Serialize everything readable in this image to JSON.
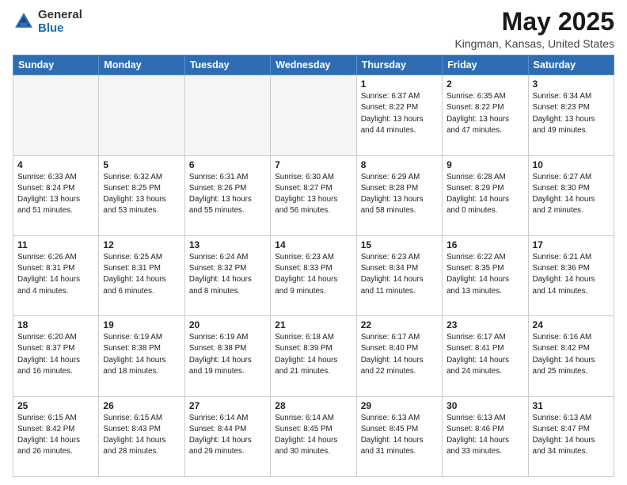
{
  "header": {
    "logo_line1": "General",
    "logo_line2": "Blue",
    "month": "May 2025",
    "location": "Kingman, Kansas, United States"
  },
  "weekdays": [
    "Sunday",
    "Monday",
    "Tuesday",
    "Wednesday",
    "Thursday",
    "Friday",
    "Saturday"
  ],
  "weeks": [
    [
      {
        "day": "",
        "info": ""
      },
      {
        "day": "",
        "info": ""
      },
      {
        "day": "",
        "info": ""
      },
      {
        "day": "",
        "info": ""
      },
      {
        "day": "1",
        "info": "Sunrise: 6:37 AM\nSunset: 8:22 PM\nDaylight: 13 hours\nand 44 minutes."
      },
      {
        "day": "2",
        "info": "Sunrise: 6:35 AM\nSunset: 8:22 PM\nDaylight: 13 hours\nand 47 minutes."
      },
      {
        "day": "3",
        "info": "Sunrise: 6:34 AM\nSunset: 8:23 PM\nDaylight: 13 hours\nand 49 minutes."
      }
    ],
    [
      {
        "day": "4",
        "info": "Sunrise: 6:33 AM\nSunset: 8:24 PM\nDaylight: 13 hours\nand 51 minutes."
      },
      {
        "day": "5",
        "info": "Sunrise: 6:32 AM\nSunset: 8:25 PM\nDaylight: 13 hours\nand 53 minutes."
      },
      {
        "day": "6",
        "info": "Sunrise: 6:31 AM\nSunset: 8:26 PM\nDaylight: 13 hours\nand 55 minutes."
      },
      {
        "day": "7",
        "info": "Sunrise: 6:30 AM\nSunset: 8:27 PM\nDaylight: 13 hours\nand 56 minutes."
      },
      {
        "day": "8",
        "info": "Sunrise: 6:29 AM\nSunset: 8:28 PM\nDaylight: 13 hours\nand 58 minutes."
      },
      {
        "day": "9",
        "info": "Sunrise: 6:28 AM\nSunset: 8:29 PM\nDaylight: 14 hours\nand 0 minutes."
      },
      {
        "day": "10",
        "info": "Sunrise: 6:27 AM\nSunset: 8:30 PM\nDaylight: 14 hours\nand 2 minutes."
      }
    ],
    [
      {
        "day": "11",
        "info": "Sunrise: 6:26 AM\nSunset: 8:31 PM\nDaylight: 14 hours\nand 4 minutes."
      },
      {
        "day": "12",
        "info": "Sunrise: 6:25 AM\nSunset: 8:31 PM\nDaylight: 14 hours\nand 6 minutes."
      },
      {
        "day": "13",
        "info": "Sunrise: 6:24 AM\nSunset: 8:32 PM\nDaylight: 14 hours\nand 8 minutes."
      },
      {
        "day": "14",
        "info": "Sunrise: 6:23 AM\nSunset: 8:33 PM\nDaylight: 14 hours\nand 9 minutes."
      },
      {
        "day": "15",
        "info": "Sunrise: 6:23 AM\nSunset: 8:34 PM\nDaylight: 14 hours\nand 11 minutes."
      },
      {
        "day": "16",
        "info": "Sunrise: 6:22 AM\nSunset: 8:35 PM\nDaylight: 14 hours\nand 13 minutes."
      },
      {
        "day": "17",
        "info": "Sunrise: 6:21 AM\nSunset: 8:36 PM\nDaylight: 14 hours\nand 14 minutes."
      }
    ],
    [
      {
        "day": "18",
        "info": "Sunrise: 6:20 AM\nSunset: 8:37 PM\nDaylight: 14 hours\nand 16 minutes."
      },
      {
        "day": "19",
        "info": "Sunrise: 6:19 AM\nSunset: 8:38 PM\nDaylight: 14 hours\nand 18 minutes."
      },
      {
        "day": "20",
        "info": "Sunrise: 6:19 AM\nSunset: 8:38 PM\nDaylight: 14 hours\nand 19 minutes."
      },
      {
        "day": "21",
        "info": "Sunrise: 6:18 AM\nSunset: 8:39 PM\nDaylight: 14 hours\nand 21 minutes."
      },
      {
        "day": "22",
        "info": "Sunrise: 6:17 AM\nSunset: 8:40 PM\nDaylight: 14 hours\nand 22 minutes."
      },
      {
        "day": "23",
        "info": "Sunrise: 6:17 AM\nSunset: 8:41 PM\nDaylight: 14 hours\nand 24 minutes."
      },
      {
        "day": "24",
        "info": "Sunrise: 6:16 AM\nSunset: 8:42 PM\nDaylight: 14 hours\nand 25 minutes."
      }
    ],
    [
      {
        "day": "25",
        "info": "Sunrise: 6:15 AM\nSunset: 8:42 PM\nDaylight: 14 hours\nand 26 minutes."
      },
      {
        "day": "26",
        "info": "Sunrise: 6:15 AM\nSunset: 8:43 PM\nDaylight: 14 hours\nand 28 minutes."
      },
      {
        "day": "27",
        "info": "Sunrise: 6:14 AM\nSunset: 8:44 PM\nDaylight: 14 hours\nand 29 minutes."
      },
      {
        "day": "28",
        "info": "Sunrise: 6:14 AM\nSunset: 8:45 PM\nDaylight: 14 hours\nand 30 minutes."
      },
      {
        "day": "29",
        "info": "Sunrise: 6:13 AM\nSunset: 8:45 PM\nDaylight: 14 hours\nand 31 minutes."
      },
      {
        "day": "30",
        "info": "Sunrise: 6:13 AM\nSunset: 8:46 PM\nDaylight: 14 hours\nand 33 minutes."
      },
      {
        "day": "31",
        "info": "Sunrise: 6:13 AM\nSunset: 8:47 PM\nDaylight: 14 hours\nand 34 minutes."
      }
    ]
  ]
}
